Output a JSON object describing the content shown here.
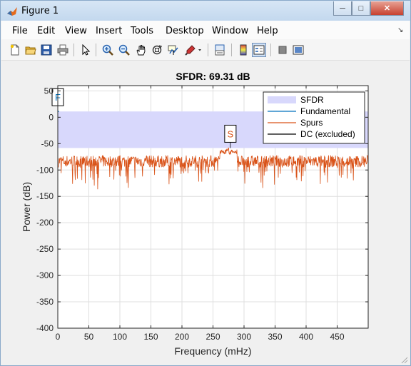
{
  "window": {
    "title": "Figure 1"
  },
  "menu": [
    "File",
    "Edit",
    "View",
    "Insert",
    "Tools",
    "Desktop",
    "Window",
    "Help"
  ],
  "toolbar": {
    "buttons": [
      {
        "name": "new-figure-button",
        "icon": "new-file-icon"
      },
      {
        "name": "open-file-button",
        "icon": "folder-icon"
      },
      {
        "name": "save-figure-button",
        "icon": "save-icon"
      },
      {
        "name": "print-figure-button",
        "icon": "printer-icon"
      },
      {
        "name": "edit-plot-button",
        "icon": "pointer-icon"
      },
      {
        "name": "zoom-in-button",
        "icon": "zoom-in-icon"
      },
      {
        "name": "zoom-out-button",
        "icon": "zoom-out-icon"
      },
      {
        "name": "pan-button",
        "icon": "hand-icon"
      },
      {
        "name": "rotate-3d-button",
        "icon": "rotate-icon"
      },
      {
        "name": "data-cursor-button",
        "icon": "data-cursor-icon"
      },
      {
        "name": "brush-button",
        "icon": "brush-icon"
      },
      {
        "name": "link-plot-button",
        "icon": "link-icon"
      },
      {
        "name": "insert-colorbar-button",
        "icon": "colorbar-icon"
      },
      {
        "name": "insert-legend-button",
        "icon": "legend-icon"
      },
      {
        "name": "hide-plot-tools-button",
        "icon": "hide-tools-icon"
      },
      {
        "name": "show-plot-tools-button",
        "icon": "show-tools-icon"
      }
    ]
  },
  "chart_data": {
    "type": "line",
    "title": "SFDR:  69.31 dB",
    "xlabel": "Frequency (mHz)",
    "ylabel": "Power (dB)",
    "xlim": [
      0,
      500
    ],
    "ylim": [
      -400,
      60
    ],
    "xticks": [
      0,
      50,
      100,
      150,
      200,
      250,
      300,
      350,
      400,
      450
    ],
    "yticks": [
      50,
      0,
      -50,
      -100,
      -150,
      -200,
      -250,
      -300,
      -350,
      -400
    ],
    "grid": true,
    "legend_position": "top-right",
    "colors": {
      "sfdr_band": "#d8d8fc",
      "fundamental": "#0072bd",
      "spurs": "#d95319",
      "dc": "#000000"
    },
    "sfdr_band": {
      "from": -58.3,
      "to": 11.0
    },
    "series": [
      {
        "name": "SFDR",
        "kind": "band"
      },
      {
        "name": "Fundamental",
        "kind": "line",
        "x": [
          0,
          0.5
        ],
        "y": [
          11.0,
          11.0
        ]
      },
      {
        "name": "Spurs",
        "kind": "noise",
        "x_range": [
          1,
          500
        ],
        "typical": [
          -95,
          -72
        ],
        "min": -138,
        "peak": {
          "x": 275,
          "y": -58.3
        }
      },
      {
        "name": "DC (excluded)",
        "kind": "line",
        "x": [
          0,
          0
        ],
        "y": [
          -400,
          -400
        ]
      }
    ],
    "markers": [
      {
        "label": "F",
        "x": 0,
        "y": 11.0,
        "color": "#0072bd"
      },
      {
        "label": "S",
        "x": 278,
        "y": -58.3,
        "color": "#d95319"
      }
    ]
  }
}
